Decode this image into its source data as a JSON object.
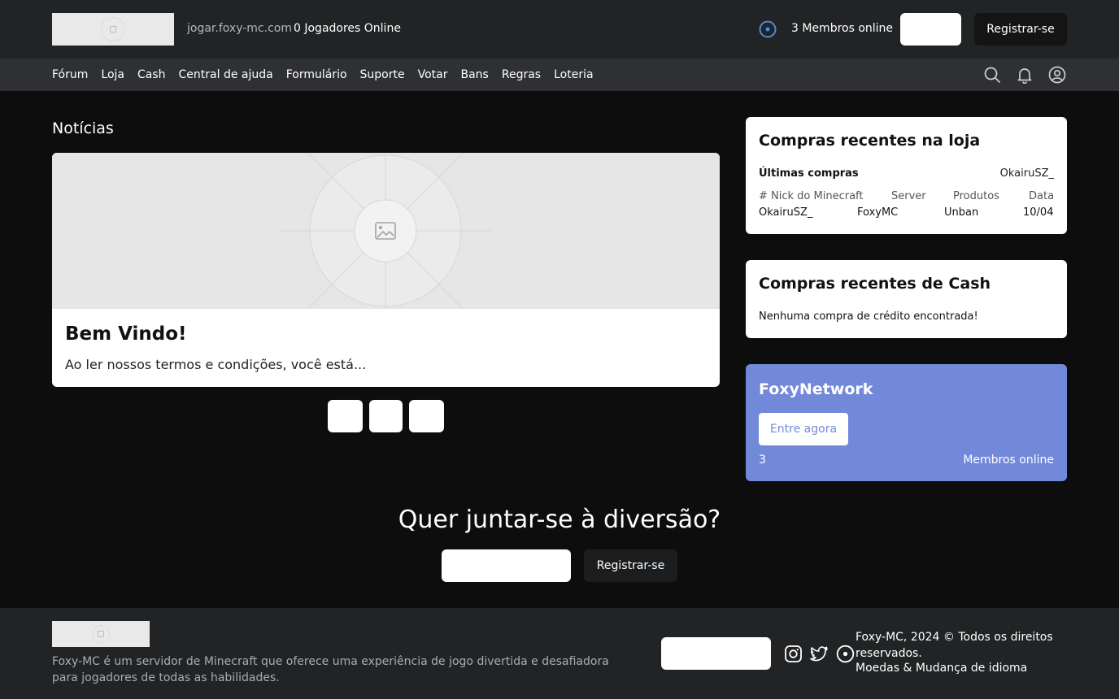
{
  "header": {
    "server_ip": "jogar.foxy-mc.com",
    "players_online": "0 Jogadores Online",
    "members_online": "3 Membros online",
    "register_label": "Registrar-se"
  },
  "nav": {
    "items": [
      "Fórum",
      "Loja",
      "Cash",
      "Central de ajuda",
      "Formulário",
      "Suporte",
      "Votar",
      "Bans",
      "Regras",
      "Loteria"
    ],
    "icons": [
      "search-icon",
      "bell-icon",
      "user-circle-icon"
    ]
  },
  "news": {
    "section_title": "Notícias",
    "heading": "Bem Vindo!",
    "excerpt": "Ao ler nossos termos e condições, você está..."
  },
  "shop_purchases": {
    "title": "Compras recentes na loja",
    "last_label": "Últimas compras",
    "last_value": "OkairuSZ_",
    "columns": [
      "# Nick do Minecraft",
      "Server",
      "Produtos",
      "Data"
    ],
    "rows": [
      [
        "OkairuSZ_",
        "FoxyMC",
        "Unban",
        "10/04"
      ]
    ]
  },
  "cash_purchases": {
    "title": "Compras recentes de Cash",
    "empty_text": "Nenhuma compra de crédito encontrada!"
  },
  "network": {
    "title": "FoxyNetwork",
    "button_label": "Entre agora",
    "count": "3",
    "count_label": "Membros online",
    "color": "#7289da"
  },
  "cta": {
    "title": "Quer juntar-se à diversão?",
    "register_label": "Registrar-se"
  },
  "footer": {
    "description": "Foxy-MC é um servidor de Minecraft que oferece uma experiência de jogo divertida e desafiadora para jogadores de todas as habilidades.",
    "copyright": "Foxy-MC, 2024 © Todos os direitos reservados.",
    "language": "Moedas & Mudança de idioma",
    "social_icons": [
      "instagram-icon",
      "twitter-icon",
      "discord-icon"
    ]
  }
}
